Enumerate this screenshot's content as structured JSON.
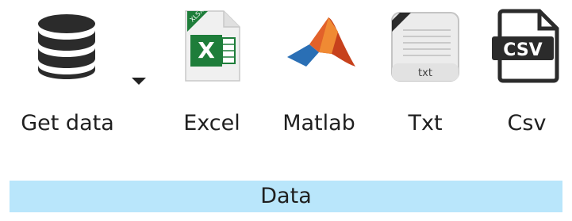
{
  "ribbon": {
    "group_label": "Data",
    "accent_color": "#b9e6fb",
    "buttons": [
      {
        "label": "Get data",
        "icon": "database-icon",
        "has_dropdown": true
      },
      {
        "label": "Excel",
        "icon": "excel-file-icon",
        "badge": "XLSX"
      },
      {
        "label": "Matlab",
        "icon": "matlab-icon"
      },
      {
        "label": "Txt",
        "icon": "txt-file-icon",
        "icon_text": "txt"
      },
      {
        "label": "Csv",
        "icon": "csv-file-icon",
        "icon_text": "CSV"
      }
    ]
  }
}
